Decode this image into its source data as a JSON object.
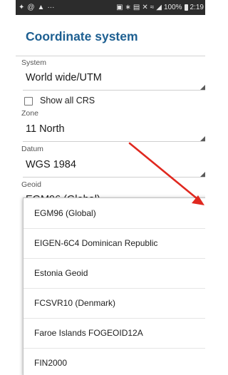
{
  "status_bar": {
    "left_icons": [
      "signal-app-icon",
      "at-icon",
      "alert-icon"
    ],
    "more": "···",
    "right_icons": [
      "nfc-icon",
      "bluetooth-icon",
      "vibrate-icon",
      "wifi-icon"
    ],
    "battery": "100%",
    "time": "2:19"
  },
  "dialog": {
    "title": "Coordinate system",
    "system": {
      "label": "System",
      "value": "World wide/UTM"
    },
    "show_all_crs": {
      "label": "Show all CRS",
      "checked": false
    },
    "zone": {
      "label": "Zone",
      "value": "11 North"
    },
    "datum": {
      "label": "Datum",
      "value": "WGS 1984"
    },
    "geoid": {
      "label": "Geoid",
      "value": "EGM96 (Global)"
    }
  },
  "geoid_dropdown": {
    "options": [
      "EGM96 (Global)",
      "EIGEN-6C4 Dominican Republic",
      "Estonia Geoid",
      "FCSVR10 (Denmark)",
      "Faroe Islands FOGEOID12A",
      "FIN2000"
    ]
  },
  "colors": {
    "title": "#1d5f91",
    "status_bar": "#2c2c2c",
    "annotation_arrow": "#e0281f"
  }
}
